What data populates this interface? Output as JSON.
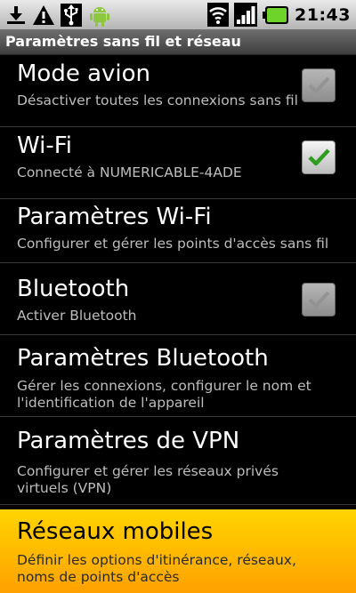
{
  "status_bar": {
    "time": "21:43",
    "left_icons": [
      "download-icon",
      "warning-icon",
      "usb-icon",
      "android-icon"
    ],
    "right_icons": [
      "wifi-signal-icon",
      "cell-signal-icon",
      "battery-icon"
    ]
  },
  "screen": {
    "title": "Paramètres sans fil et réseau"
  },
  "settings": [
    {
      "title": "Mode avion",
      "summary": "Désactiver toutes les connexions sans fil",
      "checkbox": true,
      "checked": false,
      "enabled": false
    },
    {
      "title": "Wi-Fi",
      "summary": "Connecté à NUMERICABLE-4ADE",
      "checkbox": true,
      "checked": true,
      "enabled": true
    },
    {
      "title": "Paramètres Wi-Fi",
      "summary": "Configurer et gérer les points d'accès sans fil"
    },
    {
      "title": "Bluetooth",
      "summary": "Activer Bluetooth",
      "checkbox": true,
      "checked": false,
      "enabled": false
    },
    {
      "title": "Paramètres Bluetooth",
      "summary": "Gérer les connexions, configurer le nom et l'identification de l'appareil"
    },
    {
      "title": "Paramètres de VPN",
      "summary": "Configurer et gérer les réseaux privés virtuels (VPN)"
    },
    {
      "title": "Réseaux mobiles",
      "summary": "Définir les options d'itinérance, réseaux, noms de points d'accès",
      "selected": true
    }
  ],
  "colors": {
    "highlight": "#ffb800",
    "check_green": "#2e9e1f",
    "battery_green": "#6fd42a"
  }
}
